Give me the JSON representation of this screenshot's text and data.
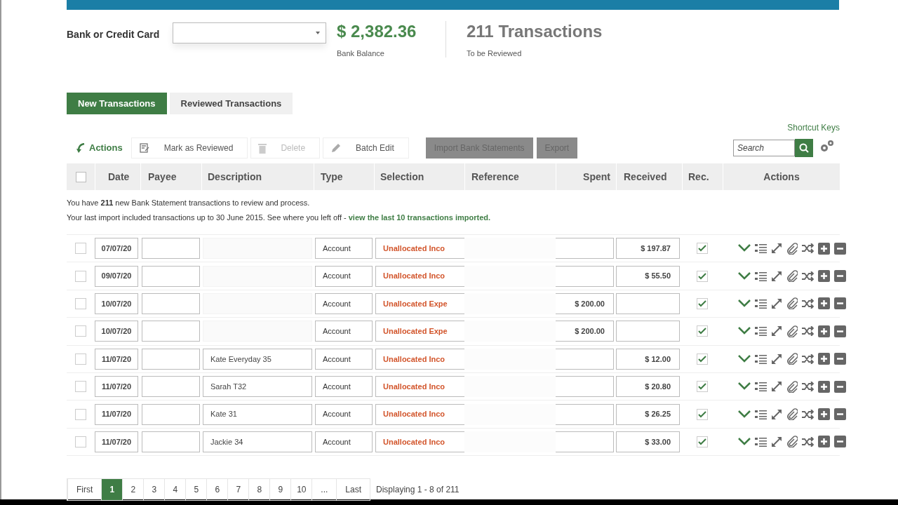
{
  "header": {
    "bank_label": "Bank or Credit Card",
    "balance": "$ 2,382.36",
    "balance_caption": "Bank Balance",
    "count": "211 Transactions",
    "count_caption": "To be Reviewed"
  },
  "tabs": [
    {
      "label": "New Transactions",
      "selected": true
    },
    {
      "label": "Reviewed Transactions",
      "selected": false
    }
  ],
  "shortcut_link": "Shortcut Keys",
  "toolbar": {
    "actions_label": "Actions",
    "buttons": [
      {
        "label": "Mark as Reviewed",
        "kind": "note",
        "disabled": false
      },
      {
        "label": "Delete",
        "kind": "trash",
        "disabled": true
      },
      {
        "label": "Batch Edit",
        "kind": "pencil",
        "disabled": false
      }
    ],
    "gray_buttons": [
      "Import Bank Statements",
      "Export"
    ],
    "search_placeholder": "Search"
  },
  "table": {
    "select_all_checked": false,
    "columns": [
      "Date",
      "Payee",
      "Description",
      "Type",
      "Selection",
      "Reference",
      "Spent",
      "Received",
      "Rec.",
      "Actions"
    ],
    "notice": "You have **211** new Bank Statement transactions to review and process.",
    "import_note": "Your last import included transactions up to 30 June 2015. See where you left off - ",
    "import_link": "view the last 10 transactions imported.",
    "rows": [
      {
        "checked": false,
        "date": "07/07/20",
        "description": "",
        "type": "Account",
        "selection": "Unallocated Inco",
        "spent": "",
        "received": "$ 197.87",
        "reconciled": true
      },
      {
        "checked": false,
        "date": "09/07/20",
        "description": "",
        "type": "Account",
        "selection": "Unallocated Inco",
        "spent": "",
        "received": "$ 55.50",
        "reconciled": true
      },
      {
        "checked": false,
        "date": "10/07/20",
        "description": "",
        "type": "Account",
        "selection": "Unallocated Expe",
        "spent": "$ 200.00",
        "received": "",
        "reconciled": true
      },
      {
        "checked": false,
        "date": "10/07/20",
        "description": "",
        "type": "Account",
        "selection": "Unallocated Expe",
        "spent": "$ 200.00",
        "received": "",
        "reconciled": true
      },
      {
        "checked": false,
        "date": "11/07/20",
        "description": "Kate Everyday 35",
        "type": "Account",
        "selection": "Unallocated Inco",
        "spent": "",
        "received": "$ 12.00",
        "reconciled": true
      },
      {
        "checked": false,
        "date": "11/07/20",
        "description": "Sarah T32",
        "type": "Account",
        "selection": "Unallocated Inco",
        "spent": "",
        "received": "$ 20.80",
        "reconciled": true
      },
      {
        "checked": false,
        "date": "11/07/20",
        "description": "Kate 31",
        "type": "Account",
        "selection": "Unallocated Inco",
        "spent": "",
        "received": "$ 26.25",
        "reconciled": true
      },
      {
        "checked": false,
        "date": "11/07/20",
        "description": "Jackie 34",
        "type": "Account",
        "selection": "Unallocated Inco",
        "spent": "",
        "received": "$ 33.00",
        "reconciled": true
      }
    ]
  },
  "pagination": {
    "pages": [
      {
        "label": "First",
        "selected": false
      },
      {
        "label": "1",
        "selected": true
      },
      {
        "label": "2",
        "selected": false
      },
      {
        "label": "3",
        "selected": false
      },
      {
        "label": "4",
        "selected": false
      },
      {
        "label": "5",
        "selected": false
      },
      {
        "label": "6",
        "selected": false
      },
      {
        "label": "7",
        "selected": false
      },
      {
        "label": "8",
        "selected": false
      },
      {
        "label": "9",
        "selected": false
      },
      {
        "label": "10",
        "selected": false
      },
      {
        "label": "...",
        "selected": false
      },
      {
        "label": "Last",
        "selected": false
      }
    ],
    "summary": "Displaying 1 - 8 of 211"
  }
}
